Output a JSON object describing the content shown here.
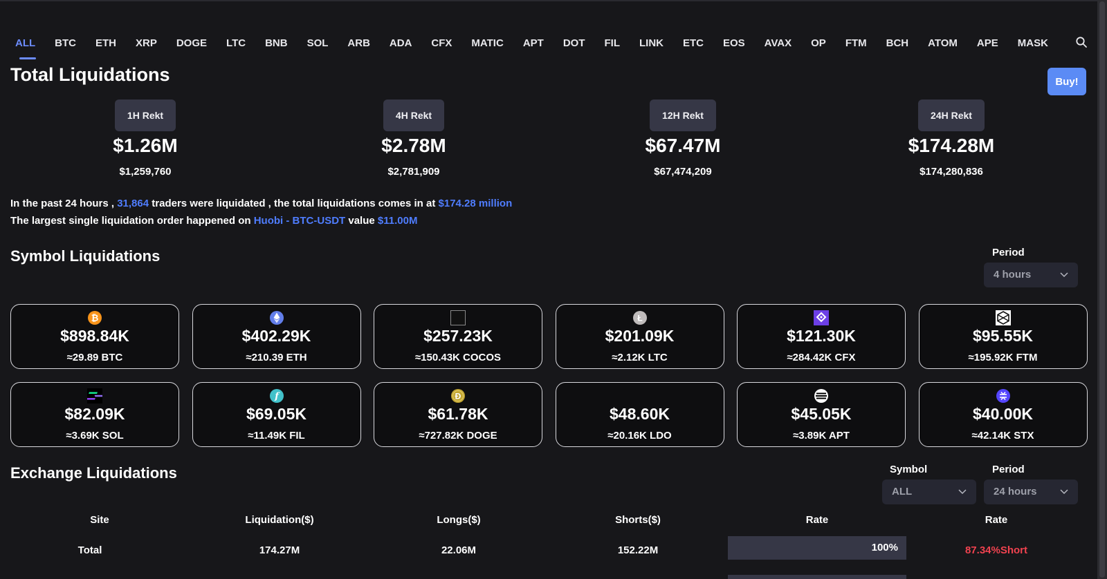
{
  "tabs": [
    "ALL",
    "BTC",
    "ETH",
    "XRP",
    "DOGE",
    "LTC",
    "BNB",
    "SOL",
    "ARB",
    "ADA",
    "CFX",
    "MATIC",
    "APT",
    "DOT",
    "FIL",
    "LINK",
    "ETC",
    "EOS",
    "AVAX",
    "OP",
    "FTM",
    "BCH",
    "ATOM",
    "APE",
    "MASK"
  ],
  "active_tab": "ALL",
  "title": "Total Liquidations",
  "buy_label": "Buy!",
  "rekt": [
    {
      "label": "1H Rekt",
      "short": "$1.26M",
      "full": "$1,259,760"
    },
    {
      "label": "4H Rekt",
      "short": "$2.78M",
      "full": "$2,781,909"
    },
    {
      "label": "12H Rekt",
      "short": "$67.47M",
      "full": "$67,474,209"
    },
    {
      "label": "24H Rekt",
      "short": "$174.28M",
      "full": "$174,280,836"
    }
  ],
  "summary": {
    "line1_a": "In the past 24 hours ,",
    "traders": "31,864",
    "line1_b": "traders were liquidated , the total liquidations comes in at",
    "total": "$174.28 million",
    "line2_a": "The largest single liquidation order happened on",
    "largest_site": "Huobi - BTC-USDT",
    "line2_b": "value",
    "largest_value": "$11.00M"
  },
  "symbol_section": {
    "title": "Symbol Liquidations",
    "period_label": "Period",
    "period_value": "4 hours"
  },
  "symbol_cards": [
    {
      "icon": "bitcoin-icon",
      "color": "#f7931a",
      "value": "$898.84K",
      "amount": "≈29.89 BTC"
    },
    {
      "icon": "ethereum-icon",
      "color": "#627eea",
      "value": "$402.29K",
      "amount": "≈210.39 ETH"
    },
    {
      "icon": "cocos-icon",
      "color": "#111111",
      "value": "$257.23K",
      "amount": "≈150.43K COCOS"
    },
    {
      "icon": "litecoin-icon",
      "color": "#bfbbbb",
      "value": "$201.09K",
      "amount": "≈2.12K LTC"
    },
    {
      "icon": "conflux-icon",
      "color": "#6c3fe6",
      "value": "$121.30K",
      "amount": "≈284.42K CFX"
    },
    {
      "icon": "fantom-icon",
      "color": "#ffffff",
      "value": "$95.55K",
      "amount": "≈195.92K FTM"
    },
    {
      "icon": "solana-icon",
      "color": "#000000",
      "value": "$82.09K",
      "amount": "≈3.69K SOL"
    },
    {
      "icon": "filecoin-icon",
      "color": "#0090ff",
      "value": "$69.05K",
      "amount": "≈11.49K FIL"
    },
    {
      "icon": "dogecoin-icon",
      "color": "#c2a633",
      "value": "$61.78K",
      "amount": "≈727.82K DOGE"
    },
    {
      "icon": "lido-icon",
      "color": "#0e0e10",
      "value": "$48.60K",
      "amount": "≈20.16K LDO"
    },
    {
      "icon": "aptos-icon",
      "color": "#ffffff",
      "value": "$45.05K",
      "amount": "≈3.89K APT"
    },
    {
      "icon": "stacks-icon",
      "color": "#5546ff",
      "value": "$40.00K",
      "amount": "≈42.14K STX"
    }
  ],
  "exchange_section": {
    "title": "Exchange Liquidations",
    "symbol_label": "Symbol",
    "symbol_value": "ALL",
    "period_label": "Period",
    "period_value": "24 hours"
  },
  "table": {
    "headers": [
      "Site",
      "Liquidation($)",
      "Longs($)",
      "Shorts($)",
      "Rate",
      "Rate"
    ],
    "total_row": {
      "site": "Total",
      "liquidation": "174.27M",
      "longs": "22.06M",
      "shorts": "152.22M",
      "rate": "100%",
      "rate_fraction": 1.0,
      "short_rate": "87.34%Short"
    }
  }
}
